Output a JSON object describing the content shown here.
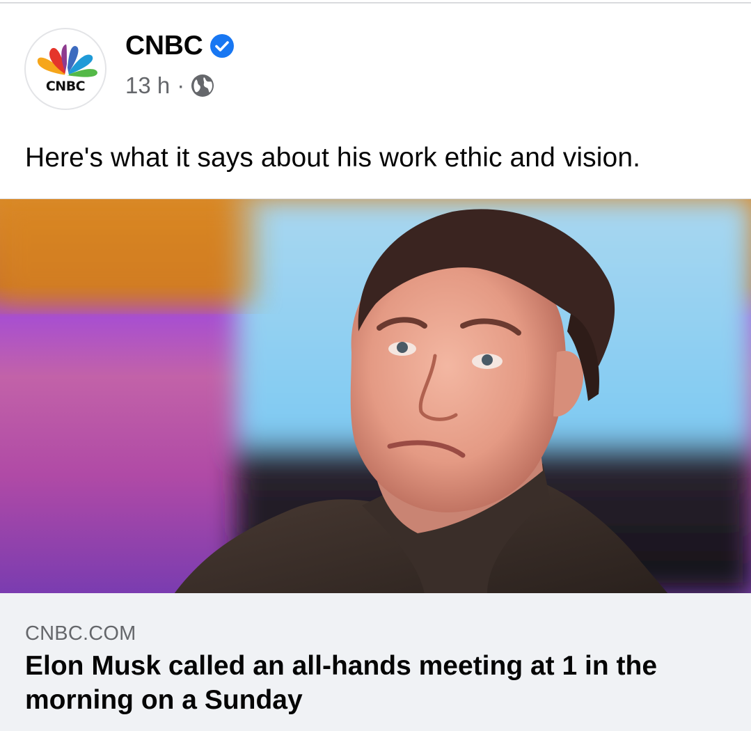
{
  "post": {
    "page_name": "CNBC",
    "avatar_wordmark": "CNBC",
    "timestamp": "13 h",
    "separator": "·",
    "text": "Here's what it says about his work ethic and vision.",
    "verified_badge_color": "#1877f2",
    "privacy_icon": "globe-icon"
  },
  "link_card": {
    "domain": "CNBC.COM",
    "title": "Elon Musk called an all-hands meeting at 1 in the morning on a Sunday"
  }
}
